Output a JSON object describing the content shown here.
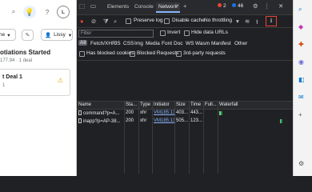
{
  "page": {
    "user_initial": "L",
    "dropdown_left": "ne",
    "dropdown_right": "Lissy",
    "stage_title": "otiations Started",
    "stage_sub": "177.94 · 1 deal",
    "deal_name": "t Deal 1",
    "deal_sub": "1"
  },
  "devtools": {
    "tabs": [
      "Elements",
      "Console",
      "Network"
    ],
    "active_tab": "Network",
    "errors": "2",
    "warnings": "46",
    "toolbar": {
      "preserve_log": "Preserve log",
      "disable_cache": "Disable cache",
      "throttling": "No throttling"
    },
    "filter_placeholder": "Filter",
    "invert": "Invert",
    "hide_data_urls": "Hide data URLs",
    "types": [
      "All",
      "Fetch/XHR",
      "JS",
      "CSS",
      "Img",
      "Media",
      "Font",
      "Doc",
      "WS",
      "Wasm",
      "Manifest",
      "Other"
    ],
    "options": [
      "Has blocked cookies",
      "Blocked Requests",
      "3rd-party requests"
    ],
    "columns": [
      "Name",
      "Sta...",
      "Type",
      "Initiator",
      "Size",
      "Time",
      "Full...",
      "Waterfall"
    ],
    "rows": [
      {
        "name": "command?p=A...",
        "status": "200",
        "type": "xhr",
        "initiator": "VM185:13",
        "size": "403...",
        "time": "443..."
      },
      {
        "name": "inapp?p=AP-38...",
        "status": "200",
        "type": "xhr",
        "initiator": "VM185:13",
        "size": "505...",
        "time": "123..."
      }
    ],
    "colors": {
      "error": "#ea4335",
      "warning": "#1a73e8",
      "export_highlight": "#ea4335"
    }
  }
}
